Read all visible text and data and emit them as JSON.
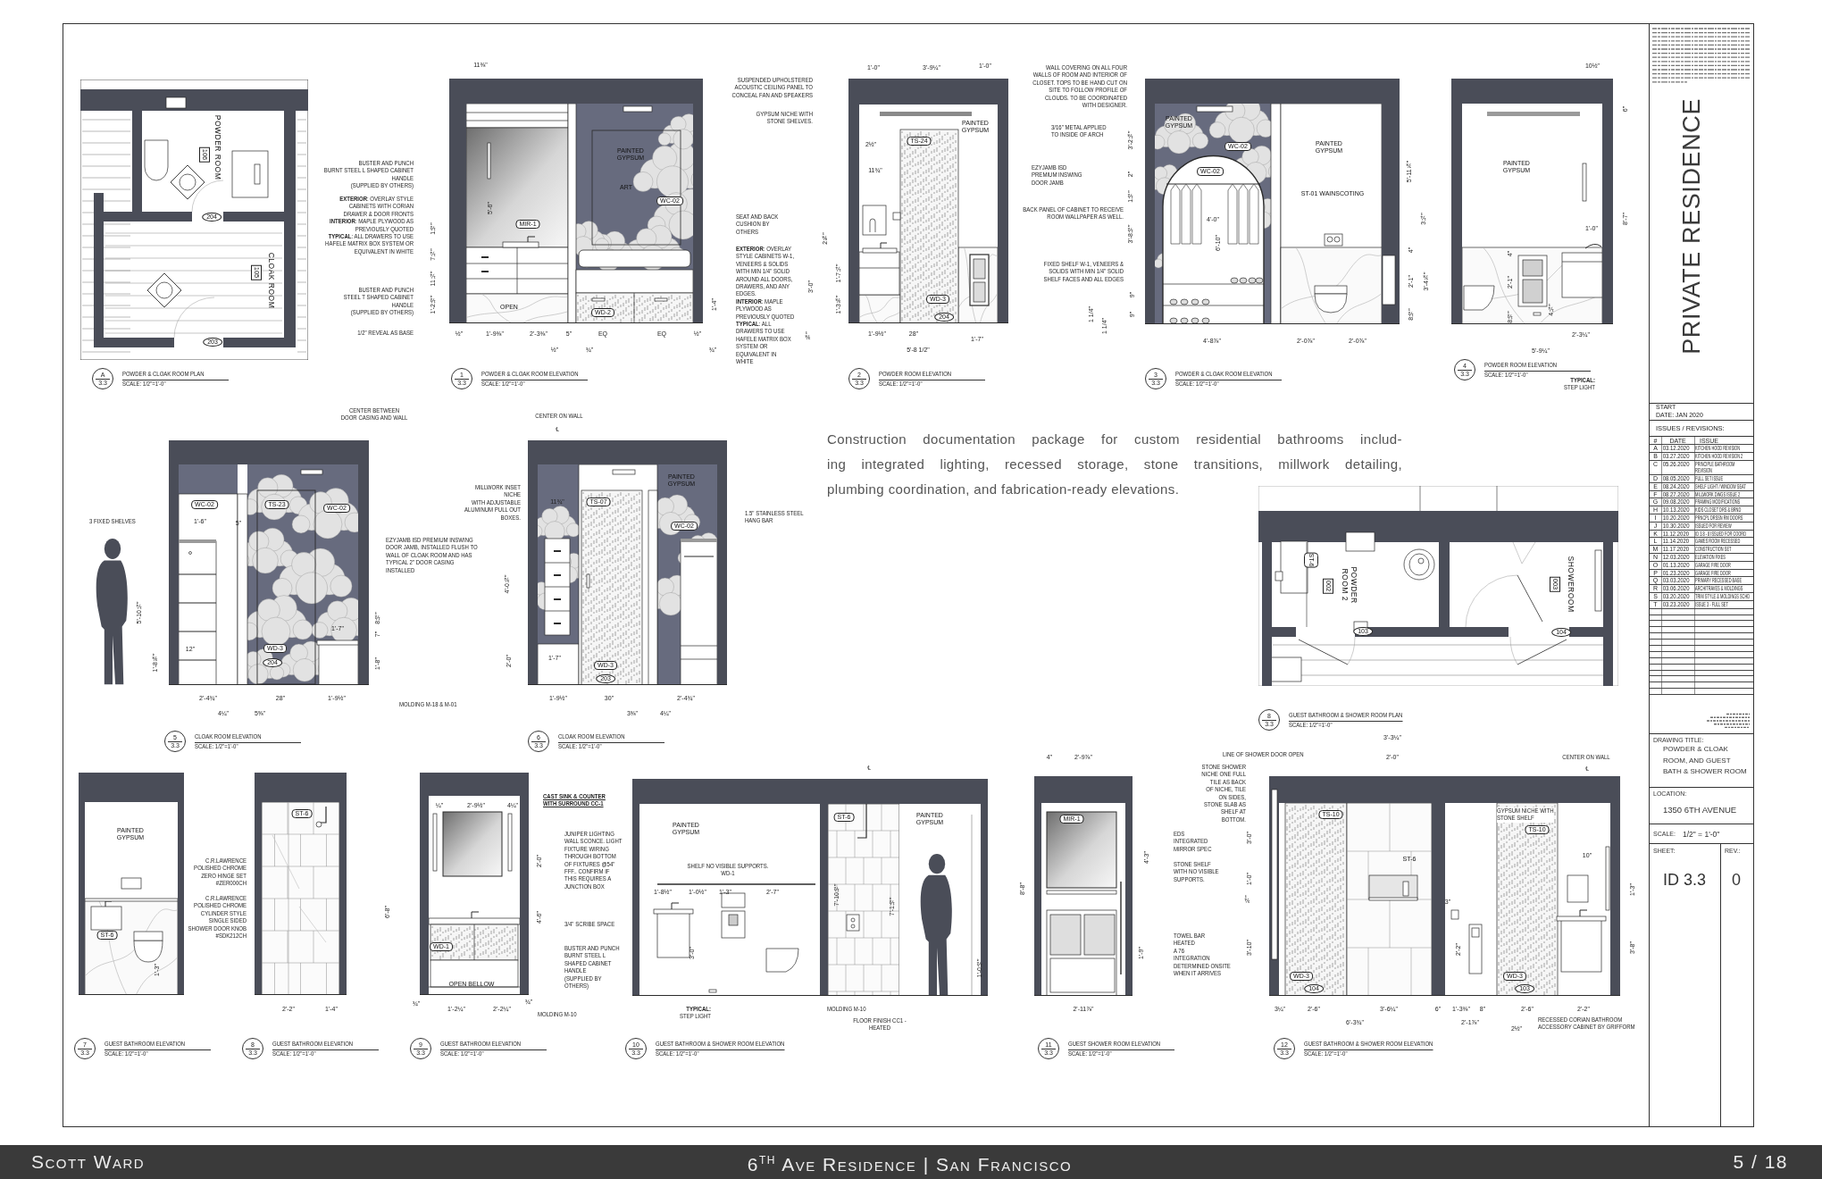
{
  "sheet": {
    "rows": [
      {
        "drawings": [
          {
            "number": "A",
            "sheet": "3.3",
            "title": "POWDER & CLOAK ROOM PLAN",
            "scale": "SCALE: 1/2\"=1'-0\"",
            "kind": "plan",
            "tags": [
              {
                "text": "POWDER ROOM",
                "kind": "label"
              },
              {
                "text": "106",
                "kind": "room"
              },
              {
                "text": "CLOAK ROOM",
                "kind": "label"
              },
              {
                "text": "105",
                "kind": "room"
              },
              {
                "text": "204",
                "kind": "door"
              },
              {
                "text": "203",
                "kind": "door"
              }
            ]
          },
          {
            "number": "1",
            "sheet": "3.3",
            "title": "POWDER & CLOAK ROOM ELEVATION",
            "scale": "SCALE: 1/2\"=1'-0\"",
            "kind": "elevation",
            "notes": [
              {
                "text": "BUSTER AND PUNCH\nBURNT STEEL L SHAPED CABINET\nHANDLE\n(SUPPLIED BY OTHERS)",
                "kind": "note"
              },
              {
                "text": "**EXTERIOR**: OVERLAY STYLE\nCABINETS WITH CORIAN\nDRAWER & DOOR FRONTS\n**INTERIOR**: MAPLE PLYWOOD AS\nPREVIOUSLY QUOTED\n**TYPICAL**: ALL DRAWERS TO USE\nHAFELE MATRIX BOX SYSTEM OR\nEQUIVALENT IN WHITE",
                "kind": "note"
              },
              {
                "text": "BUSTER AND PUNCH\nSTEEL T SHAPED CABINET\nHANDLE\n(SUPPLIED BY OTHERS)",
                "kind": "note"
              },
              {
                "text": "1/2\" REVEAL AS BASE",
                "kind": "note"
              },
              {
                "text": "SEAT AND BACK\nCUSHION BY\nOTHERS",
                "kind": "note"
              },
              {
                "text": "**EXTERIOR**: OVERLAY\nSTYLE CABINETS W-1,\nVENEERS & SOLIDS\nWITH MIN 1/4\" SOLID\nAROUND ALL DOORS,\nDRAWERS, AND ANY\nEDGES.\n**INTERIOR**: MAPLE\nPLYWOOD AS\nPREVIOUSLY QUOTED\n**TYPICAL**: ALL\nDRAWERS TO USE\nHAFELE MATRIX BOX\nSYSTEM OR\nEQUIVALENT IN\nWHITE",
                "kind": "note"
              }
            ],
            "tags": [
              {
                "text": "MIR-1",
                "kind": "tag"
              },
              {
                "text": "PAINTED\nGYPSUM",
                "kind": "label"
              },
              {
                "text": "ART",
                "kind": "label"
              },
              {
                "text": "WC-02",
                "kind": "tag"
              },
              {
                "text": "OPEN",
                "kind": "label"
              },
              {
                "text": "WD-2",
                "kind": "tag"
              }
            ],
            "dims": [
              "11⅜\"",
              "5'-6\"",
              "1½\"",
              "7¼\"",
              "11¼\"",
              "1'-2½\"",
              "½\"",
              "1'-9⅜\"",
              "2'-3⅜\"",
              "5\"",
              "EQ",
              "EQ",
              "½\"",
              "½\"",
              "¾\"",
              "¾\"",
              "1'-4\""
            ]
          },
          {
            "number": "2",
            "sheet": "3.3",
            "title": "POWDER ROOM ELEVATION",
            "scale": "SCALE: 1/2\"=1'-0\"",
            "kind": "elevation",
            "notes": [
              {
                "text": "SUSPENDED UPHOLSTERED\nACOUSTIC CEILING PANEL TO\nCONCEAL FAN AND SPEAKERS",
                "kind": "note"
              },
              {
                "text": "GYPSUM NICHE WITH\nSTONE SHELVES.",
                "kind": "note"
              }
            ],
            "tags": [
              {
                "text": "PAINTED\nGYPSUM",
                "kind": "label"
              },
              {
                "text": "TS-24",
                "kind": "tag"
              },
              {
                "text": "WD-3",
                "kind": "tag"
              },
              {
                "text": "204",
                "kind": "door"
              }
            ],
            "dims": [
              "1'-0\"",
              "3'-9¼\"",
              "1'-0\"",
              "2½\"",
              "11¾\"",
              "2⅝\"",
              "1'-7¼\"",
              "3'-0\"",
              "1'-3⅜\"",
              "⅜\"",
              "1'-9½\"",
              "28\"",
              "1'-7\"",
              "5'-8 1/2\""
            ]
          },
          {
            "number": "3",
            "sheet": "3.3",
            "title": "POWDER & CLOAK ROOM ELEVATION",
            "scale": "SCALE: 1/2\"=1'-0\"",
            "kind": "elevation",
            "notes": [
              {
                "text": "WALL COVERING ON ALL FOUR\nWALLS OF ROOM AND INTERIOR OF\nCLOSET. TOPS TO BE HAND CUT ON\nSITE TO FOLLOW PROFILE OF\nCLOUDS. TO BE COORDINATED\nWITH DESIGNER.",
                "kind": "note"
              },
              {
                "text": "3/16\" METAL APPLIED\nTO INSIDE OF ARCH",
                "kind": "note"
              },
              {
                "text": "EZYJAMB ISD\nPREMIUM INSWING\nDOOR JAMB",
                "kind": "note"
              },
              {
                "text": "BACK PANEL OF CABINET TO RECEIVE\nROOM WALLPAPER AS WELL.",
                "kind": "note"
              },
              {
                "text": "FIXED SHELF W-1, VENEERS &\nSOLIDS WITH MIN 1/4\" SOLID\nSHELF FACES AND ALL EDGES",
                "kind": "note"
              }
            ],
            "tags": [
              {
                "text": "PAINTED\nGYPSUM",
                "kind": "label"
              },
              {
                "text": "WC-02",
                "kind": "tag"
              },
              {
                "text": "WC-02",
                "kind": "tag"
              },
              {
                "text": "PAINTED\nGYPSUM",
                "kind": "label"
              },
              {
                "text": "ST-01 WAINSCOTING",
                "kind": "label"
              }
            ],
            "dims": [
              "4'-0\"",
              "6'-10\"",
              "3'-2⅛\"",
              "2\"",
              "1½\"",
              "3'-8½\"",
              "9\"",
              "9\"",
              "1 1/4\"",
              "1 1/4\"",
              "5'-11⅞\"",
              "3¼\"",
              "4\"",
              "2'-1\"",
              "3'-4⅞\"",
              "8½\"",
              "4'-8⅞\"",
              "2'-0⅞\"",
              "2'-0⅞\""
            ]
          },
          {
            "number": "4",
            "sheet": "3.3",
            "title": "POWDER ROOM ELEVATION",
            "scale": "SCALE: 1/2\"=1'-0\"",
            "kind": "elevation",
            "notes": [
              {
                "text": "**TYPICAL:**\nSTEP LIGHT",
                "kind": "note"
              }
            ],
            "tags": [
              {
                "text": "PAINTED\nGYPSUM",
                "kind": "label"
              }
            ],
            "dims": [
              "10½\"",
              "6\"",
              "8'-7\"",
              "1'-0\"",
              "4\"",
              "2'-1\"",
              "8½\"",
              "4¼\"",
              "2'-3¼\"",
              "5'-9¼\""
            ]
          }
        ]
      },
      {
        "drawings": [
          {
            "number": "5",
            "sheet": "3.3",
            "title": "CLOAK ROOM ELEVATION",
            "scale": "SCALE: 1/2\"=1'-0\"",
            "kind": "elevation",
            "notes": [
              {
                "text": "CENTER BETWEEN\nDOOR CASING AND WALL",
                "kind": "note"
              },
              {
                "text": "3 FIXED SHELVES",
                "kind": "note"
              },
              {
                "text": "EZYJAMB ISD PREMIUM INSWING\nDOOR JAMB, INSTALLED FLUSH TO\nWALL OF CLOAK ROOM AND HAS\nTYPICAL 2\" DOOR CASING\nINSTALLED",
                "kind": "note"
              },
              {
                "text": "MOLDING M-18 & M-01",
                "kind": "note"
              }
            ],
            "tags": [
              {
                "text": "WC-02",
                "kind": "tag"
              },
              {
                "text": "TS-23",
                "kind": "tag"
              },
              {
                "text": "WC-02",
                "kind": "tag"
              },
              {
                "text": "WD-3",
                "kind": "tag"
              },
              {
                "text": "204",
                "kind": "door"
              }
            ],
            "dims": [
              "1'-6\"",
              "5\"",
              "5'-10¼\"",
              "1'-8⅜\"",
              "12\"",
              "8½\"",
              "7\"",
              "1'-7\"",
              "1'-8\"",
              "2'-4¾\"",
              "28\"",
              "1'-9½\"",
              "4¼\"",
              "5⅝\""
            ]
          },
          {
            "number": "6",
            "sheet": "3.3",
            "title": "CLOAK ROOM ELEVATION",
            "scale": "SCALE: 1/2\"=1'-0\"",
            "kind": "elevation",
            "notes": [
              {
                "text": "CENTER ON WALL",
                "kind": "note"
              },
              {
                "text": "MILLWORK INSET\nNICHE\nWITH ADJUSTABLE\nALUMINUM PULL OUT\nBOXES.",
                "kind": "note"
              },
              {
                "text": "1.5\" STAINLESS STEEL\nHANG BAR",
                "kind": "note"
              }
            ],
            "tags": [
              {
                "text": "℄",
                "kind": "label"
              },
              {
                "text": "TS-07",
                "kind": "tag"
              },
              {
                "text": "PAINTED\nGYPSUM",
                "kind": "label"
              },
              {
                "text": "WC-02",
                "kind": "tag"
              },
              {
                "text": "WD-3",
                "kind": "tag"
              },
              {
                "text": "203",
                "kind": "door"
              }
            ],
            "dims": [
              "11¾\"",
              "1'-7\"",
              "4'-0¾\"",
              "2'-0\"",
              "1'-9½\"",
              "30\"",
              "2'-4¾\"",
              "3⅜\"",
              "4¼\""
            ]
          },
          {
            "number": "8",
            "sheet": "3.3",
            "title": "GUEST BATHROOM & SHOWER ROOM PLAN",
            "scale": "SCALE: 1/2\"=1'-0\"",
            "kind": "plan",
            "tags": [
              {
                "text": "ST-6",
                "kind": "tag"
              },
              {
                "text": "POWDER\nROOM 2",
                "kind": "label"
              },
              {
                "text": "002",
                "kind": "room"
              },
              {
                "text": "SHOWEROOM",
                "kind": "label"
              },
              {
                "text": "003",
                "kind": "room"
              },
              {
                "text": "103",
                "kind": "door"
              },
              {
                "text": "104",
                "kind": "door"
              }
            ]
          }
        ],
        "description": [
          "Construction documentation package for custom residential bathrooms includ-",
          "ing integrated lighting, recessed storage, stone transitions, millwork detailing,",
          "plumbing coordination, and fabrication-ready elevations."
        ]
      },
      {
        "drawings": [
          {
            "number": "7",
            "sheet": "3.3",
            "title": "GUEST BATHROOM ELEVATION",
            "scale": "SCALE: 1/2\"=1'-0\"",
            "kind": "elevation",
            "notes": [
              {
                "text": "C.R.LAWRENCE\nPOLISHED CHROME\nZERO HINGE SET\n#ZER000CH",
                "kind": "note"
              },
              {
                "text": "C.R.LAWRENCE\nPOLISHED CHROME\nCYLINDER STYLE\nSINGLE SIDED\nSHOWER DOOR KNOB\n#SDK212CH",
                "kind": "note"
              }
            ],
            "tags": [
              {
                "text": "PAINTED\nGYPSUM",
                "kind": "label"
              },
              {
                "text": "ST-6",
                "kind": "tag"
              }
            ],
            "dims": [
              "1'-3\""
            ]
          },
          {
            "number": "8",
            "sheet": "3.3",
            "title": "GUEST BATHROOM ELEVATION",
            "scale": "SCALE: 1/2\"=1'-0\"",
            "kind": "elevation",
            "tags": [
              {
                "text": "ST-6",
                "kind": "tag"
              }
            ],
            "dims": [
              "6'-8\"",
              "2'-2\"",
              "1'-4\""
            ]
          },
          {
            "number": "9",
            "sheet": "3.3",
            "title": "GUEST BATHROOM ELEVATION",
            "scale": "SCALE: 1/2\"=1'-0\"",
            "kind": "elevation",
            "notes": [
              {
                "text": "CAST SINK & COUNTER\nWITH SURROUND CC-1",
                "kind": "heading"
              },
              {
                "text": "JUNIPER LIGHTING\nWALL SCONCE. LIGHT\nFIXTURE WIRING\nTHROUGH BOTTOM\nOF FIXTURES @54\"\nFFF.. CONFIRM IF\nTHIS REQUIRES A\nJUNCTION BOX",
                "kind": "note"
              },
              {
                "text": "3/4\" SCRIBE SPACE",
                "kind": "note"
              },
              {
                "text": "BUSTER AND PUNCH\nBURNT STEEL L\nSHAPED CABINET\nHANDLE\n(SUPPLIED BY\nOTHERS)",
                "kind": "note"
              },
              {
                "text": "MOLDING M-10",
                "kind": "note"
              }
            ],
            "tags": [
              {
                "text": "WD-1",
                "kind": "tag"
              },
              {
                "text": "OPEN BELLOW",
                "kind": "label"
              }
            ],
            "dims": [
              "¼\"",
              "2'-9½\"",
              "4¼\"",
              "2'-0\"",
              "4'-6\"",
              "1'-2¼\"",
              "2'-2¼\"",
              "¾\"",
              "¾\""
            ]
          },
          {
            "number": "10",
            "sheet": "3.3",
            "title": "GUEST BATHROOM & SHOWER ROOM ELEVATION",
            "scale": "SCALE: 1/2\"=1'-0\"",
            "kind": "elevation",
            "notes": [
              {
                "text": "SHELF NO VISIBLE SUPPORTS.\nWD-1",
                "kind": "note"
              },
              {
                "text": "**TYPICAL:**\nSTEP LIGHT",
                "kind": "note"
              },
              {
                "text": "MOLDING M-10",
                "kind": "note"
              },
              {
                "text": "FLOOR FINISH CC1 -\nHEATED",
                "kind": "note"
              }
            ],
            "tags": [
              {
                "text": "PAINTED\nGYPSUM",
                "kind": "label"
              },
              {
                "text": "ST-6",
                "kind": "tag"
              },
              {
                "text": "PAINTED\nGYPSUM",
                "kind": "label"
              },
              {
                "text": "℄",
                "kind": "label"
              }
            ],
            "dims": [
              "1'-8½\"",
              "1'-0½\"",
              "1'-3\"",
              "2'-7\"",
              "3'-0\"",
              "7'-10½\"",
              "7'-1½\"",
              "1'-0½\""
            ]
          },
          {
            "number": "11",
            "sheet": "3.3",
            "title": "GUEST SHOWER ROOM ELEVATION",
            "scale": "SCALE: 1/2\"=1'-0\"",
            "kind": "elevation",
            "notes": [
              {
                "text": "EDS\nINTEGRATED\nMIRROR SPEC",
                "kind": "note"
              },
              {
                "text": "STONE SHELF\nWITH NO VISIBLE\nSUPPORTS.",
                "kind": "note"
              },
              {
                "text": "TOWEL BAR\nHEATED\nA 76\nINTEGRATION\nDETERMINED ONSITE\nWHEN IT ARRIVES",
                "kind": "note"
              }
            ],
            "tags": [
              {
                "text": "MIR-1",
                "kind": "tag"
              }
            ],
            "dims": [
              "4\"",
              "2'-9⅞\"",
              "8'-8\"",
              "2'-11⅞\"",
              "4'-3\"",
              "1'-9\""
            ]
          },
          {
            "number": "12",
            "sheet": "3.3",
            "title": "GUEST BATHROOM & SHOWER ROOM ELEVATION",
            "scale": "SCALE: 1/2\"=1'-0\"",
            "kind": "elevation",
            "notes": [
              {
                "text": "LINE OF SHOWER DOOR OPEN",
                "kind": "note"
              },
              {
                "text": "STONE SHOWER\nNICHE ONE FULL\nTILE AS BACK\nOF NICHE, TILE\nON SIDES,\nSTONE SLAB AS\nSHELF AT\nBOTTOM.",
                "kind": "note"
              },
              {
                "text": "CENTER ON WALL",
                "kind": "note"
              },
              {
                "text": "GYPSUM NICHE WITH\nSTONE SHELF",
                "kind": "note"
              },
              {
                "text": "RECESSED CORIAN BATHROOM\nACCESSORY CABINET BY GRIFFORM",
                "kind": "note"
              }
            ],
            "tags": [
              {
                "text": "TS-10",
                "kind": "tag"
              },
              {
                "text": "ST-6",
                "kind": "label"
              },
              {
                "text": "TS-10",
                "kind": "tag"
              },
              {
                "text": "WD-3",
                "kind": "tag"
              },
              {
                "text": "WD-3",
                "kind": "tag"
              },
              {
                "text": "104",
                "kind": "door"
              },
              {
                "text": "103",
                "kind": "door"
              },
              {
                "text": "℄",
                "kind": "label"
              }
            ],
            "dims": [
              "3'-3¼\"",
              "2'-0\"",
              "3'-0\"",
              "1'-0\"",
              "¾\"",
              "3'-10\"",
              "3\"",
              "2'-2\"",
              "10\"",
              "1'-3\"",
              "3'-8\"",
              "3¼\"",
              "2'-6\"",
              "3'-6¼\"",
              "6\"",
              "1'-3⅜\"",
              "8\"",
              "2'-6\"",
              "2'-2\"",
              "6'-3¾\"",
              "2'-1⅞\"",
              "2½\""
            ]
          }
        ]
      }
    ]
  },
  "title_block": {
    "project": "PRIVATE RESIDENCE",
    "start": "START",
    "date": "DATE: JAN 2020",
    "revisions_heading": "ISSUES / REVISIONS:",
    "columns": [
      "#",
      "DATE",
      "ISSUE"
    ],
    "revisions": [
      {
        "mark": "A",
        "date": "03.12.2020",
        "issue": "KITCHEN HOOD REVISION"
      },
      {
        "mark": "B",
        "date": "03.27.2020",
        "issue": "KITCHEN HOOD REVISION 2"
      },
      {
        "mark": "C",
        "date": "05.26.2020",
        "issue": "PRINCIPLE BATHROOM\nREVISION"
      },
      {
        "mark": "D",
        "date": "08.05.2020",
        "issue": "FULL SET ISSUE"
      },
      {
        "mark": "E",
        "date": "08.24.2020",
        "issue": "SHELF LIGHT / WINDOW SEAT"
      },
      {
        "mark": "F",
        "date": "08.27.2020",
        "issue": "MILLWORK DWGS ISSUE 2"
      },
      {
        "mark": "G",
        "date": "09.08.2020",
        "issue": "FRAMING MODIFICATIONS"
      },
      {
        "mark": "H",
        "date": "10.13.2020",
        "issue": "KIDS CLOSET DRS & BRND"
      },
      {
        "mark": "I",
        "date": "10.20.2020",
        "issue": "PRNCPL DRSSN RM DOORS"
      },
      {
        "mark": "J",
        "date": "10.30.2020",
        "issue": "ISSUED FOR REVIEW"
      },
      {
        "mark": "K",
        "date": "11.12.2020",
        "issue": "ID 3.8 - 8 ISSUED FOR COORD"
      },
      {
        "mark": "L",
        "date": "11.14.2020",
        "issue": "GAMES ROOM RECESSED"
      },
      {
        "mark": "M",
        "date": "11.17.2020",
        "issue": "CONSTRUCTION SET"
      },
      {
        "mark": "N",
        "date": "12.03.2020",
        "issue": "ELEVATION FIXES"
      },
      {
        "mark": "O",
        "date": "01.13.2020",
        "issue": "GARAGE FIRE DOOR"
      },
      {
        "mark": "P",
        "date": "01.23.2020",
        "issue": "GARAGE FIRE DOOR"
      },
      {
        "mark": "Q",
        "date": "03.03.2020",
        "issue": "PRIMARY RECESSED BASE"
      },
      {
        "mark": "R",
        "date": "03.06.2020",
        "issue": "ARCHITRAVES & MOLDINGS"
      },
      {
        "mark": "S",
        "date": "03.20.2020",
        "issue": "TRIM STYLE & MOLDINGS SCHD"
      },
      {
        "mark": "T",
        "date": "03.23.2020",
        "issue": "ISSUE 3 - FULL SET"
      }
    ],
    "drawing_title_label": "DRAWING TITLE:",
    "drawing_title": "POWDER & CLOAK\nROOM, AND GUEST\nBATH & SHOWER ROOM",
    "location_label": "LOCATION:",
    "location": "1350 6TH AVENUE",
    "scale_label": "SCALE:",
    "scale": "1/2\" = 1'-0\"",
    "sheet_label": "SHEET:",
    "rev_label": "REV.:",
    "sheet": "ID 3.3",
    "rev": "0"
  },
  "footer": {
    "author": "Scott Ward",
    "project": "6$^{th}$ Ave Residence | San Francisco",
    "page": "5 / 18"
  }
}
